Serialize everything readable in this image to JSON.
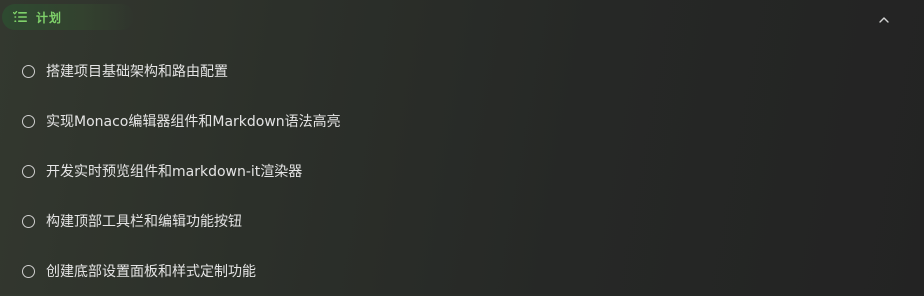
{
  "plan": {
    "title": "计划",
    "icon": "task-list-icon",
    "accent_color": "#7fd26a",
    "collapse_icon": "chevron-up-icon",
    "collapsed": false
  },
  "tasks": [
    {
      "label": "搭建项目基础架构和路由配置",
      "completed": false
    },
    {
      "label": "实现Monaco编辑器组件和Markdown语法高亮",
      "completed": false
    },
    {
      "label": "开发实时预览组件和markdown-it渲染器",
      "completed": false
    },
    {
      "label": "构建顶部工具栏和编辑功能按钮",
      "completed": false
    },
    {
      "label": "创建底部设置面板和样式定制功能",
      "completed": false
    }
  ]
}
